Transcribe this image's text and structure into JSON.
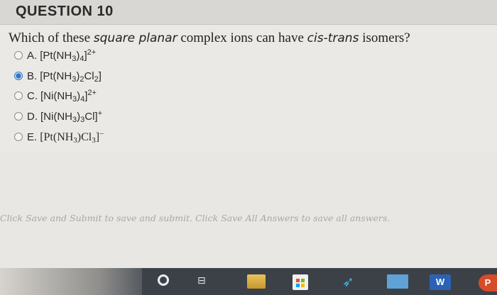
{
  "header": {
    "title": "QUESTION 10"
  },
  "question": {
    "prefix": "Which of these ",
    "italic1": "square planar",
    "middle": " complex ions can have ",
    "italic2": "cis-trans",
    "suffix": " isomers?"
  },
  "options": [
    {
      "letter": "A.",
      "selected": false,
      "formula_html": "[Pt(NH<sub>3</sub>)<sub>4</sub>]<sup>2+</sup>"
    },
    {
      "letter": "B.",
      "selected": true,
      "formula_html": "[Pt(NH<sub>3</sub>)<sub>2</sub>Cl<sub>2</sub>]"
    },
    {
      "letter": "C.",
      "selected": false,
      "formula_html": "[Ni(NH<sub>3</sub>)<sub>4</sub>]<sup>2+</sup>"
    },
    {
      "letter": "D.",
      "selected": false,
      "formula_html": "[Ni(NH<sub>3</sub>)<sub>3</sub>Cl]<sup>+</sup>"
    },
    {
      "letter": "E.",
      "selected": false,
      "formula_html": "[Pt(NH<sub>3</sub>)Cl<sub>3</sub>]<sup>&minus;</sup>"
    }
  ],
  "footer": {
    "part1": "Click Save and Submit to save and submit. Click Save All Answers to save all answers."
  },
  "taskbar": {
    "icons": [
      "cortana-icon",
      "task-view-icon",
      "file-explorer-icon",
      "store-icon",
      "feather-app-icon",
      "mail-icon",
      "word-icon",
      "powerpoint-icon"
    ],
    "word_label": "W",
    "ppt_label": "P"
  },
  "colors": {
    "radio_selected": "#2f77d0",
    "page_bg": "#e9e7e3",
    "taskbar_bg": "#3c4148"
  }
}
